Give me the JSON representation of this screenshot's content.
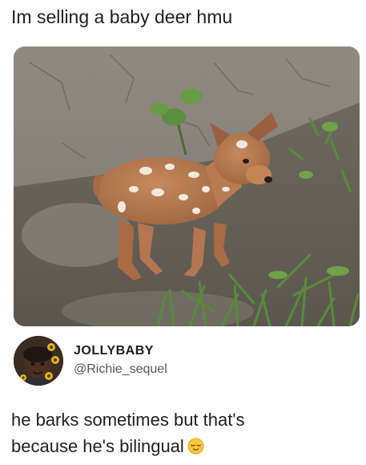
{
  "post": {
    "caption": "Im selling a baby deer hmu",
    "photo_icon": "puppy-photo"
  },
  "reply": {
    "author_name": "JOLLYBABY",
    "author_handle": "@Richie_sequel",
    "avatar_icon": "profile-avatar",
    "text_line1": "he barks sometimes but that's",
    "text_line2": "because he's bilingual",
    "emoji_icon": "relieved-face-emoji"
  },
  "colors": {
    "text": "#1f1f1f",
    "handle": "#555555",
    "background": "#ffffff"
  }
}
